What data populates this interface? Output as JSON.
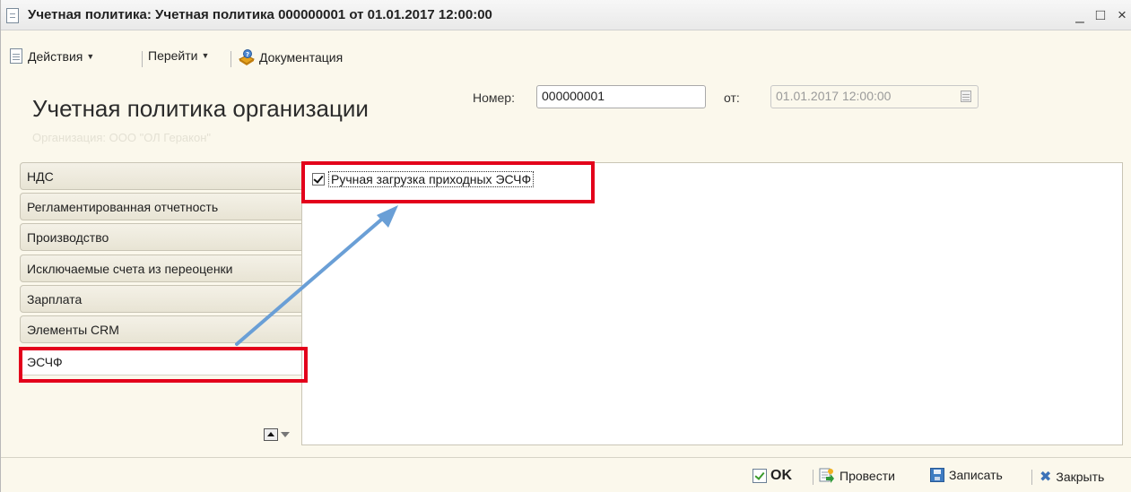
{
  "window": {
    "title": "Учетная политика: Учетная политика 000000001 от 01.01.2017 12:00:00",
    "controls": {
      "minimize": "_",
      "maximize": "□",
      "close": "×"
    }
  },
  "toolbar": {
    "actions_label": "Действия",
    "goto_label": "Перейти",
    "docs_label": "Документация"
  },
  "header": {
    "page_title": "Учетная политика организации",
    "number_label": "Номер:",
    "number_value": "000000001",
    "date_label": "от:",
    "date_value": "01.01.2017 12:00:00",
    "org_line": "Организация: ООО \"ОЛ Геракон\""
  },
  "tabs": [
    {
      "label": "НДС"
    },
    {
      "label": "Регламентированная отчетность"
    },
    {
      "label": "Производство"
    },
    {
      "label": "Исключаемые счета из переоценки"
    },
    {
      "label": "Зарплата"
    },
    {
      "label": "Элементы CRM"
    },
    {
      "label": "ЭСЧФ",
      "active": true
    }
  ],
  "content": {
    "checkbox_label": "Ручная загрузка приходных ЭСЧФ",
    "checkbox_checked": true
  },
  "bottom": {
    "ok_label": "OK",
    "post_label": "Провести",
    "save_label": "Записать",
    "close_label": "Закрыть"
  },
  "colors": {
    "highlight": "#e3001b",
    "arrow": "#6a9fd6",
    "background": "#fbf8ec"
  }
}
